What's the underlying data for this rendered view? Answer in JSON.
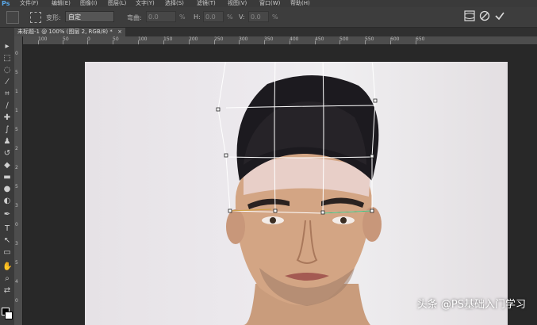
{
  "app": {
    "logo": "Ps"
  },
  "menubar": {
    "items": [
      "文件(F)",
      "编辑(E)",
      "图像(I)",
      "图层(L)",
      "文字(Y)",
      "选择(S)",
      "滤镜(T)",
      "视图(V)",
      "窗口(W)",
      "帮助(H)"
    ]
  },
  "options": {
    "transform_label": "变形:",
    "transform_value": "自定",
    "bend_label": "弯曲:",
    "bend_value": "0.0",
    "h_label": "H:",
    "h_value": "0.0",
    "v_label": "V:",
    "v_value": "0.0",
    "percent": "%"
  },
  "document": {
    "tab_title": "未标题-1 @ 100% (图层 2, RGB/8) *",
    "close_glyph": "×"
  },
  "ruler": {
    "h_ticks": [
      "100",
      "50",
      "0",
      "50",
      "100",
      "150",
      "200",
      "250",
      "300",
      "350",
      "400",
      "450",
      "500",
      "550",
      "600",
      "650"
    ],
    "v_ticks": [
      "0",
      "5",
      "1",
      "1",
      "5",
      "2",
      "2",
      "5",
      "3",
      "0",
      "3",
      "5",
      "4",
      "0"
    ]
  },
  "icons": {
    "warp_mode": "warp-mode-icon",
    "cancel": "cancel-icon",
    "commit": "commit-icon"
  },
  "colors": {
    "warp_grid": "#ffffff",
    "handle": "#222222",
    "accent_line": "#d0a040",
    "eye_guide": "#40c080"
  },
  "watermark": {
    "text": "头条 @PS基础入门学习"
  }
}
